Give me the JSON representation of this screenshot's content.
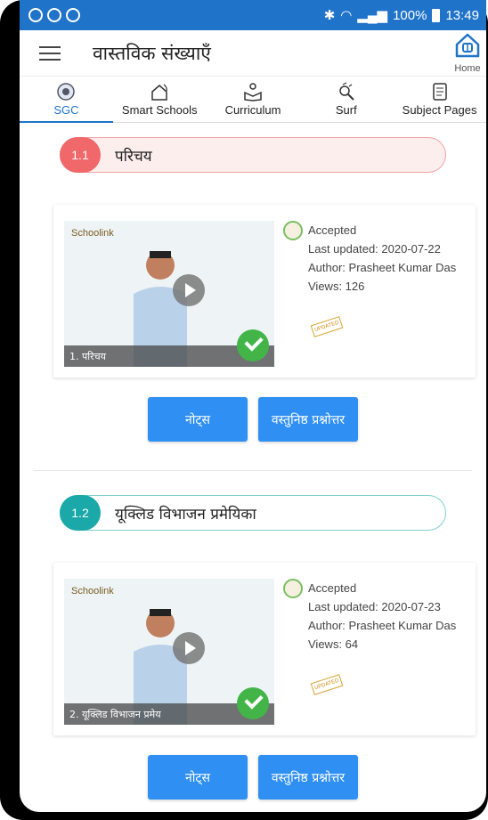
{
  "status_bar": {
    "right_text": "100%",
    "time": "13:49"
  },
  "app_bar": {
    "title": "वास्तविक संख्याएँ",
    "home_label": "Home"
  },
  "tabs": [
    {
      "label": "SGC",
      "icon": "sgc-logo-icon",
      "active": true
    },
    {
      "label": "Smart Schools",
      "icon": "smart-school-icon",
      "active": false
    },
    {
      "label": "Curriculum",
      "icon": "curriculum-icon",
      "active": false
    },
    {
      "label": "Surf",
      "icon": "surf-icon",
      "active": false
    },
    {
      "label": "Subject Pages",
      "icon": "subject-pages-icon",
      "active": false
    }
  ],
  "sections": [
    {
      "number": "1.1",
      "title": "परिचय",
      "color": "#f0686a",
      "video": {
        "logo_text": "Schoolink",
        "caption": "1. परिचय",
        "status": "Accepted",
        "last_updated": "Last updated: 2020-07-22",
        "author": "Author: Prasheet Kumar Das",
        "views": "Views: 126",
        "stamp": "UPDATED"
      },
      "buttons": {
        "notes": "नोट्स",
        "objective": "वस्तुनिष्ठ प्रश्नोत्तर"
      }
    },
    {
      "number": "1.2",
      "title": "यूक्लिड विभाजन प्रमेयिका",
      "color": "#1aa8a8",
      "video": {
        "logo_text": "Schoolink",
        "caption": "2. यूक्लिड विभाजन प्रमेय",
        "status": "Accepted",
        "last_updated": "Last updated: 2020-07-23",
        "author": "Author: Prasheet Kumar Das",
        "views": "Views: 64",
        "stamp": "UPDATED"
      },
      "buttons": {
        "notes": "नोट्स",
        "objective": "वस्तुनिष्ठ प्रश्नोत्तर"
      }
    }
  ]
}
